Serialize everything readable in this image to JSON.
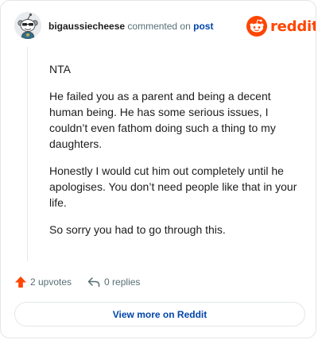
{
  "header": {
    "username": "bigaussiecheese",
    "action_text": "commented on",
    "post_link": "post",
    "brand": "reddit"
  },
  "comment": {
    "paragraphs": [
      "NTA",
      "He failed you as a parent and being a decent human being. He has some serious issues, I couldn’t even fathom doing such a thing to my daughters.",
      "Honestly I would cut him out completely until he apologises. You don’t need people like that in your life.",
      "So sorry you had to go through this."
    ]
  },
  "stats": {
    "upvotes": "2 upvotes",
    "replies": "0 replies"
  },
  "footer": {
    "view_more": "View more on Reddit"
  },
  "colors": {
    "brand": "#ff4500",
    "link": "#0045ac",
    "muted": "#576f76"
  }
}
